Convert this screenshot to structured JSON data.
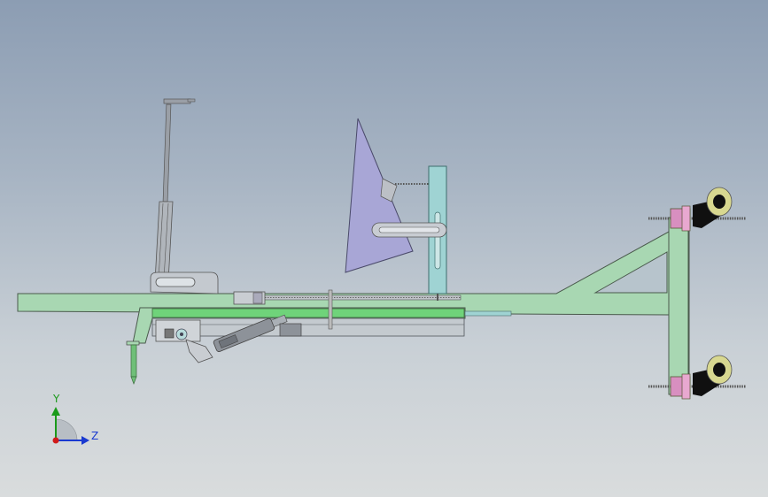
{
  "viewport": {
    "background_top": "#8c9db3",
    "background_bottom": "#d9dcdd"
  },
  "triad": {
    "y_label": "Y",
    "z_label": "Z",
    "y_color": "#1a9a1a",
    "z_color": "#1a3ad0",
    "x_color": "#d01a1a"
  },
  "colors": {
    "frame_green": "#a8d7b2",
    "frame_outline": "#4a5a4c",
    "inner_green": "#6fd37a",
    "triangle_purple": "#a8a6d6",
    "post_teal": "#9fd3d3",
    "wheel_black": "#101010",
    "wheel_yellow": "#d8d890",
    "pink": "#d88fc0",
    "gray_part": "#9a9fa6"
  }
}
